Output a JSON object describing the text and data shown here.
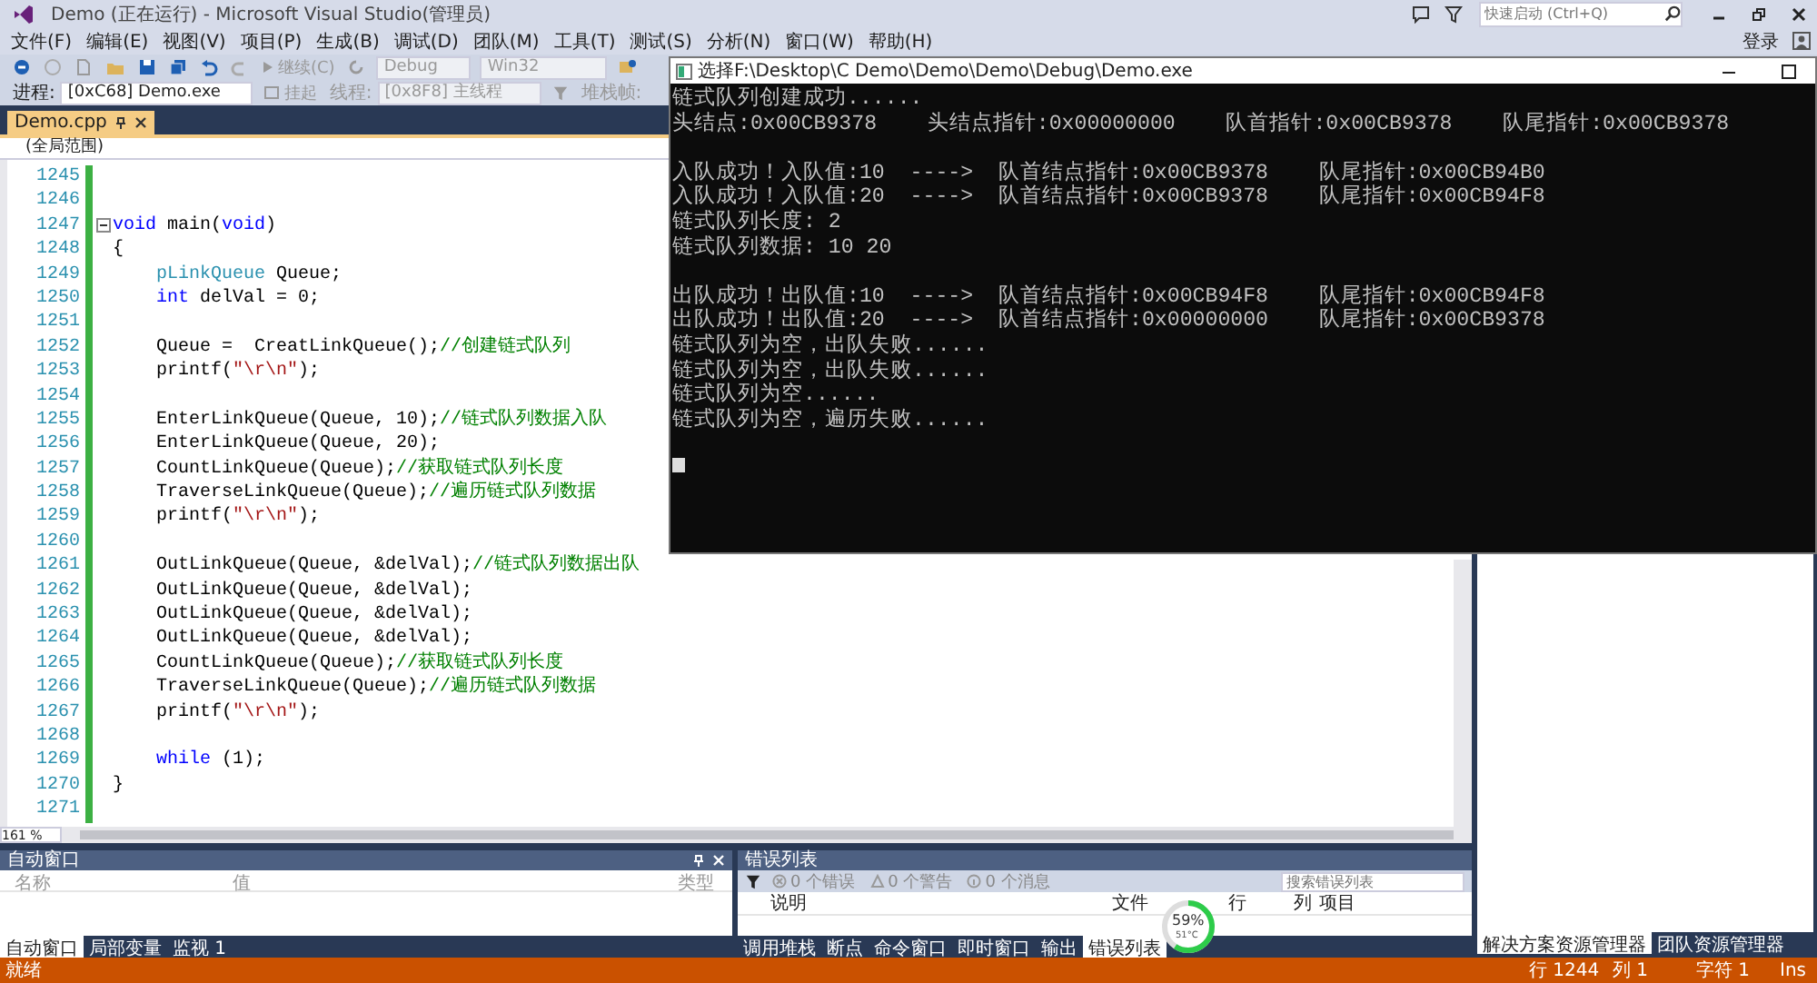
{
  "window": {
    "title": "Demo (正在运行) - Microsoft Visual Studio(管理员)",
    "quick_launch": {
      "placeholder": "快速启动 (Ctrl+Q)"
    },
    "sign_in": "登录"
  },
  "menu": [
    "文件(F)",
    "编辑(E)",
    "视图(V)",
    "项目(P)",
    "生成(B)",
    "调试(D)",
    "团队(M)",
    "工具(T)",
    "测试(S)",
    "分析(N)",
    "窗口(W)",
    "帮助(H)"
  ],
  "toolbar": {
    "continue": "继续(C)",
    "configuration": "Debug",
    "platform": "Win32"
  },
  "debug_location": {
    "process_label": "进程:",
    "process": "[0xC68] Demo.exe",
    "suspend": "挂起",
    "thread_label": "线程:",
    "thread": "[0x8F8] 主线程",
    "stack_frame_label": "堆栈帧:"
  },
  "document_tabs": [
    {
      "label": "Demo.cpp",
      "selected": true
    }
  ],
  "editor": {
    "scope": "(全局范围)",
    "zoom": "161 %",
    "lines": [
      {
        "number": "1245"
      },
      {
        "number": "1246"
      },
      {
        "number": "1247",
        "foldable": true,
        "segments": [
          {
            "kind": "keyword",
            "text": "void"
          },
          {
            "kind": "plain",
            "text": " main("
          },
          {
            "kind": "keyword",
            "text": "void"
          },
          {
            "kind": "plain",
            "text": ")"
          }
        ]
      },
      {
        "number": "1248",
        "segments": [
          {
            "kind": "plain",
            "text": "{"
          }
        ]
      },
      {
        "number": "1249",
        "segments": [
          {
            "kind": "type",
            "text": "    pLinkQueue"
          },
          {
            "kind": "plain",
            "text": " Queue;"
          }
        ]
      },
      {
        "number": "1250",
        "segments": [
          {
            "kind": "keyword",
            "text": "    int"
          },
          {
            "kind": "plain",
            "text": " delVal = 0;"
          }
        ]
      },
      {
        "number": "1251"
      },
      {
        "number": "1252",
        "segments": [
          {
            "kind": "plain",
            "text": "    Queue =  CreatLinkQueue();"
          },
          {
            "kind": "comment",
            "text": "//创建链式队列"
          }
        ]
      },
      {
        "number": "1253",
        "segments": [
          {
            "kind": "plain",
            "text": "    printf("
          },
          {
            "kind": "string",
            "text": "\"\\r\\n\""
          },
          {
            "kind": "plain",
            "text": ");"
          }
        ]
      },
      {
        "number": "1254"
      },
      {
        "number": "1255",
        "segments": [
          {
            "kind": "plain",
            "text": "    EnterLinkQueue(Queue, 10);"
          },
          {
            "kind": "comment",
            "text": "//链式队列数据入队"
          }
        ]
      },
      {
        "number": "1256",
        "segments": [
          {
            "kind": "plain",
            "text": "    EnterLinkQueue(Queue, 20);"
          }
        ]
      },
      {
        "number": "1257",
        "segments": [
          {
            "kind": "plain",
            "text": "    CountLinkQueue(Queue);"
          },
          {
            "kind": "comment",
            "text": "//获取链式队列长度"
          }
        ]
      },
      {
        "number": "1258",
        "segments": [
          {
            "kind": "plain",
            "text": "    TraverseLinkQueue(Queue);"
          },
          {
            "kind": "comment",
            "text": "//遍历链式队列数据"
          }
        ]
      },
      {
        "number": "1259",
        "segments": [
          {
            "kind": "plain",
            "text": "    printf("
          },
          {
            "kind": "string",
            "text": "\"\\r\\n\""
          },
          {
            "kind": "plain",
            "text": ");"
          }
        ]
      },
      {
        "number": "1260"
      },
      {
        "number": "1261",
        "segments": [
          {
            "kind": "plain",
            "text": "    OutLinkQueue(Queue, &delVal);"
          },
          {
            "kind": "comment",
            "text": "//链式队列数据出队"
          }
        ]
      },
      {
        "number": "1262",
        "segments": [
          {
            "kind": "plain",
            "text": "    OutLinkQueue(Queue, &delVal);"
          }
        ]
      },
      {
        "number": "1263",
        "segments": [
          {
            "kind": "plain",
            "text": "    OutLinkQueue(Queue, &delVal);"
          }
        ]
      },
      {
        "number": "1264",
        "segments": [
          {
            "kind": "plain",
            "text": "    OutLinkQueue(Queue, &delVal);"
          }
        ]
      },
      {
        "number": "1265",
        "segments": [
          {
            "kind": "plain",
            "text": "    CountLinkQueue(Queue);"
          },
          {
            "kind": "comment",
            "text": "//获取链式队列长度"
          }
        ]
      },
      {
        "number": "1266",
        "segments": [
          {
            "kind": "plain",
            "text": "    TraverseLinkQueue(Queue);"
          },
          {
            "kind": "comment",
            "text": "//遍历链式队列数据"
          }
        ]
      },
      {
        "number": "1267",
        "segments": [
          {
            "kind": "plain",
            "text": "    printf("
          },
          {
            "kind": "string",
            "text": "\"\\r\\n\""
          },
          {
            "kind": "plain",
            "text": ");"
          }
        ]
      },
      {
        "number": "1268"
      },
      {
        "number": "1269",
        "segments": [
          {
            "kind": "keyword",
            "text": "    while"
          },
          {
            "kind": "plain",
            "text": " (1);"
          }
        ]
      },
      {
        "number": "1270",
        "segments": [
          {
            "kind": "plain",
            "text": "}"
          }
        ]
      },
      {
        "number": "1271"
      }
    ]
  },
  "console": {
    "title": "选择F:\\Desktop\\C Demo\\Demo\\Demo\\Debug\\Demo.exe",
    "blocks": [
      [
        "链式队列创建成功......",
        "头结点:0x00CB9378    头结点指针:0x00000000    队首指针:0x00CB9378    队尾指针:0x00CB9378"
      ],
      [
        "入队成功！入队值:10  ---->  队首结点指针:0x00CB9378    队尾指针:0x00CB94B0",
        "入队成功！入队值:20  ---->  队首结点指针:0x00CB9378    队尾指针:0x00CB94F8",
        "链式队列长度: 2",
        "链式队列数据: 10 20"
      ],
      [
        "出队成功！出队值:10  ---->  队首结点指针:0x00CB94F8    队尾指针:0x00CB94F8",
        "出队成功！出队值:20  ---->  队首结点指针:0x00000000    队尾指针:0x00CB9378",
        "链式队列为空，出队失败......",
        "链式队列为空，出队失败......",
        "链式队列为空......",
        "链式队列为空，遍历失败......"
      ]
    ]
  },
  "autos": {
    "title": "自动窗口",
    "columns": [
      "名称",
      "值",
      "类型"
    ],
    "tabs": [
      {
        "label": "自动窗口",
        "selected": true
      },
      {
        "label": "局部变量",
        "selected": false
      },
      {
        "label": "监视 1",
        "selected": false
      }
    ]
  },
  "error_list": {
    "title": "错误列表",
    "errors": "0 个错误",
    "warnings": "0 个警告",
    "messages": "0 个消息",
    "search": {
      "placeholder": "搜索错误列表"
    },
    "columns": [
      "说明",
      "文件",
      "行",
      "列",
      "项目"
    ],
    "tabs": [
      {
        "label": "调用堆栈",
        "selected": false
      },
      {
        "label": "断点",
        "selected": false
      },
      {
        "label": "命令窗口",
        "selected": false
      },
      {
        "label": "即时窗口",
        "selected": false
      },
      {
        "label": "输出",
        "selected": false
      },
      {
        "label": "错误列表",
        "selected": true
      }
    ]
  },
  "side_tabs": [
    {
      "label": "解决方案资源管理器",
      "selected": true
    },
    {
      "label": "团队资源管理器",
      "selected": false
    }
  ],
  "gauge": {
    "level": 0.59,
    "percent": "59%",
    "temperature": "51°C"
  },
  "status_bar": {
    "message": "就绪",
    "line": "行 1244",
    "column": "列 1",
    "char": "字符 1",
    "mode": "Ins"
  }
}
